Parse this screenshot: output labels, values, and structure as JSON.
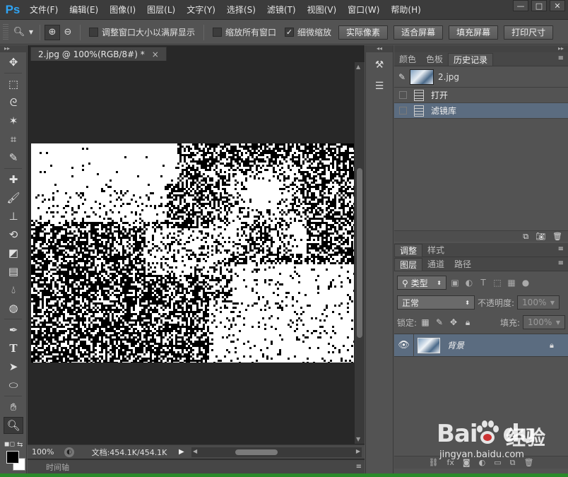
{
  "app": {
    "logo": "Ps"
  },
  "menu": [
    "文件(F)",
    "编辑(E)",
    "图像(I)",
    "图层(L)",
    "文字(Y)",
    "选择(S)",
    "滤镜(T)",
    "视图(V)",
    "窗口(W)",
    "帮助(H)"
  ],
  "window_controls": {
    "minimize": "—",
    "maximize": "□",
    "close": "✕"
  },
  "options": {
    "resize_windows_label": "调整窗口大小以满屏显示",
    "resize_windows_checked": false,
    "zoom_all_label": "缩放所有窗口",
    "zoom_all_checked": false,
    "scrubby_zoom_label": "细微缩放",
    "scrubby_zoom_checked": true,
    "actual_pixels": "实际像素",
    "fit_screen": "适合屏幕",
    "fill_screen": "填充屏幕",
    "print_size": "打印尺寸"
  },
  "tools": [
    "move-icon",
    "marquee-icon",
    "lasso-icon",
    "magic-wand-icon",
    "crop-icon",
    "eyedropper-icon",
    "healing-brush-icon",
    "brush-icon",
    "clone-stamp-icon",
    "history-brush-icon",
    "eraser-icon",
    "gradient-icon",
    "blur-icon",
    "dodge-icon",
    "pen-icon",
    "type-icon",
    "path-selection-icon",
    "shape-icon",
    "hand-icon",
    "zoom-icon"
  ],
  "document": {
    "tab_title": "2.jpg @ 100%(RGB/8#) *",
    "zoom": "100%",
    "doc_info": "文档:454.1K/454.1K"
  },
  "timeline_label": "时间轴",
  "history_panel": {
    "tabs": [
      "颜色",
      "色板",
      "历史记录"
    ],
    "active_tab": 2,
    "snapshot_name": "2.jpg",
    "states": [
      {
        "label": "打开",
        "selected": false
      },
      {
        "label": "滤镜库",
        "selected": true
      }
    ]
  },
  "adjust_panel": {
    "tabs": [
      "调整",
      "样式"
    ],
    "active_tab": 0
  },
  "layers_panel": {
    "tabs": [
      "图层",
      "通道",
      "路径"
    ],
    "active_tab": 0,
    "filter_label": "类型",
    "blend_mode": "正常",
    "opacity_label": "不透明度:",
    "opacity_value": "100%",
    "lock_label": "锁定:",
    "fill_label": "填充:",
    "fill_value": "100%",
    "layers": [
      {
        "name": "背景",
        "visible": true,
        "locked": true
      }
    ]
  },
  "watermark": {
    "brand": "Bai",
    "brand2": "du",
    "suffix": "经验",
    "url": "jingyan.baidu.com"
  },
  "colors": {
    "foreground": "#000000",
    "background": "#ffffff",
    "selection": "#5b6c80",
    "ps_blue": "#2fa4f4"
  }
}
